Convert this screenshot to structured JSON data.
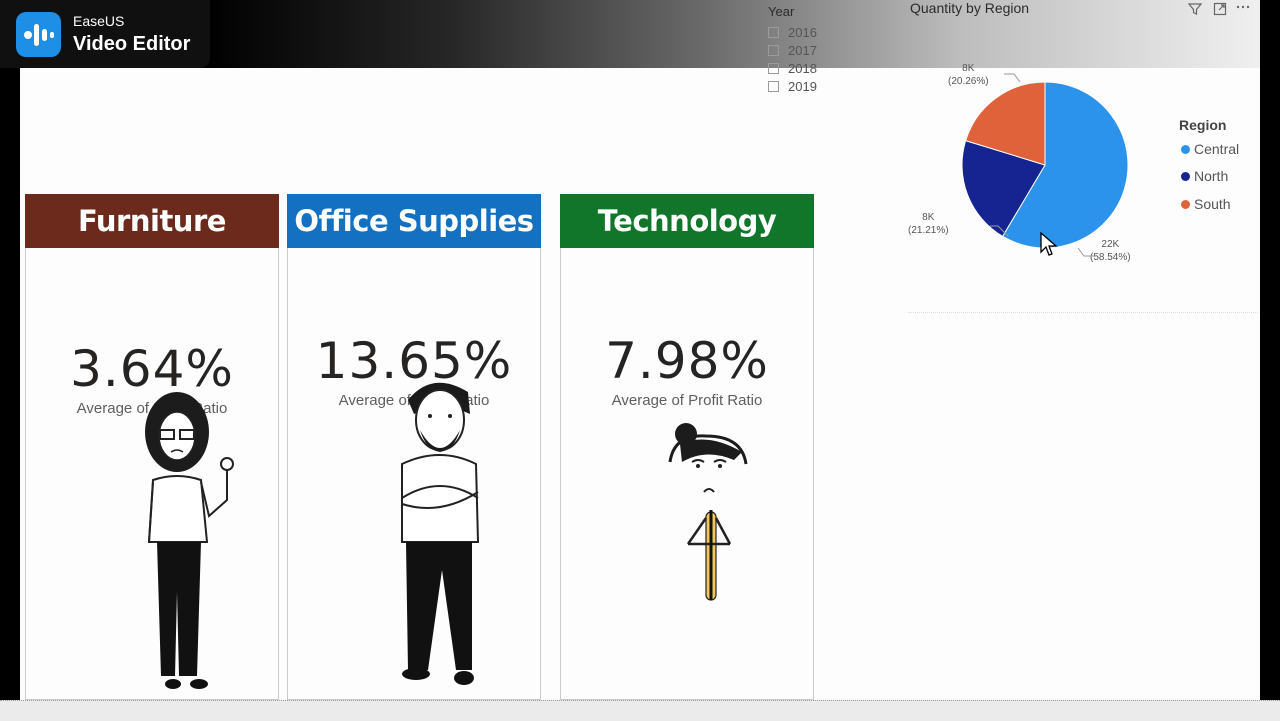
{
  "app": {
    "brand_small": "EaseUS",
    "brand_name": "Video Editor"
  },
  "slicer": {
    "title": "Year",
    "items": [
      {
        "label": "2016"
      },
      {
        "label": "2017"
      },
      {
        "label": "2018"
      },
      {
        "label": "2019"
      }
    ]
  },
  "cards": [
    {
      "header": "Furniture",
      "header_color": "#6b2a1c",
      "value": "3.64%",
      "label": "Average of Profit Ratio"
    },
    {
      "header": "Office Supplies",
      "header_color": "#1471c2",
      "value": "13.65%",
      "label": "Average of Profit Ratio"
    },
    {
      "header": "Technology",
      "header_color": "#11762a",
      "value": "7.98%",
      "label": "Average of Profit Ratio"
    }
  ],
  "visual": {
    "title": "Quantity by Region",
    "icons": [
      "filter-icon",
      "focus-mode-icon",
      "more-options-icon"
    ]
  },
  "chart_data": {
    "type": "pie",
    "title": "Quantity by Region",
    "legend_title": "Region",
    "legend_position": "right",
    "slices": [
      {
        "name": "Central",
        "value_label": "22K",
        "percent_label": "(58.54%)",
        "percent": 58.54,
        "color": "#2b93ec"
      },
      {
        "name": "North",
        "value_label": "8K",
        "percent_label": "(21.21%)",
        "percent": 21.21,
        "color": "#152490"
      },
      {
        "name": "South",
        "value_label": "8K",
        "percent_label": "(20.26%)",
        "percent": 20.26,
        "color": "#e0623a"
      }
    ]
  }
}
